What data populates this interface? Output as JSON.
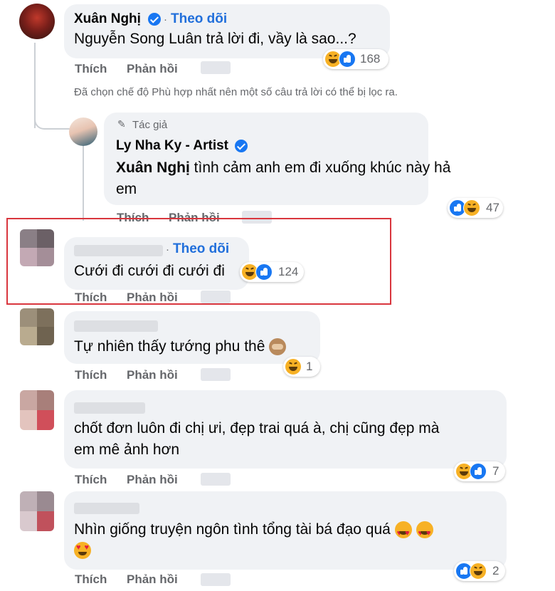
{
  "colors": {
    "follow_blue": "#216fdb",
    "bubble_bg": "#f0f2f5",
    "meta_gray": "#65676b",
    "highlight_red": "#d9363e"
  },
  "actions": {
    "like": "Thích",
    "reply": "Phản hồi"
  },
  "follow_label": "Theo dõi",
  "comments": [
    {
      "author": "Xuân Nghị",
      "verified": true,
      "text": "Nguyễn Song Luân trả lời đi, vầy là sao...?",
      "reactions": [
        "haha",
        "like"
      ],
      "count": "168"
    },
    {
      "author_badge_icon": "pencil-icon",
      "author_badge": "Tác giả",
      "author": "Ly Nha Ky - Artist",
      "verified": true,
      "tag": "Xuân Nghị",
      "text_line1": " tình cảm anh em đi xuống khúc này hả",
      "text_line2": "em",
      "reactions": [
        "like",
        "haha"
      ],
      "count": "47"
    },
    {
      "text": "Cưới đi cưới đi cưới đi",
      "reactions": [
        "haha",
        "like"
      ],
      "count": "124"
    },
    {
      "text": "Tự nhiên thấy tướng phu thê",
      "emoji_icon": "see-no-evil-monkey-icon",
      "reactions": [
        "haha"
      ],
      "count": "1"
    },
    {
      "text_line1": "chốt đơn luôn đi chị ưi, đẹp trai quá à, chị cũng đẹp mà",
      "text_line2": "em mê ảnh hơn",
      "reactions": [
        "haha",
        "like"
      ],
      "count": "7"
    },
    {
      "text_line1": "Nhìn giống truyện ngôn tình tổng tài bá đạo quá",
      "emoji_icon": "heart-eyes-icon",
      "reactions": [
        "like",
        "haha"
      ],
      "count": "2"
    }
  ],
  "filter_notice": "Đã chọn chế độ Phù hợp nhất nên một số câu trả lời có thể bị lọc ra."
}
